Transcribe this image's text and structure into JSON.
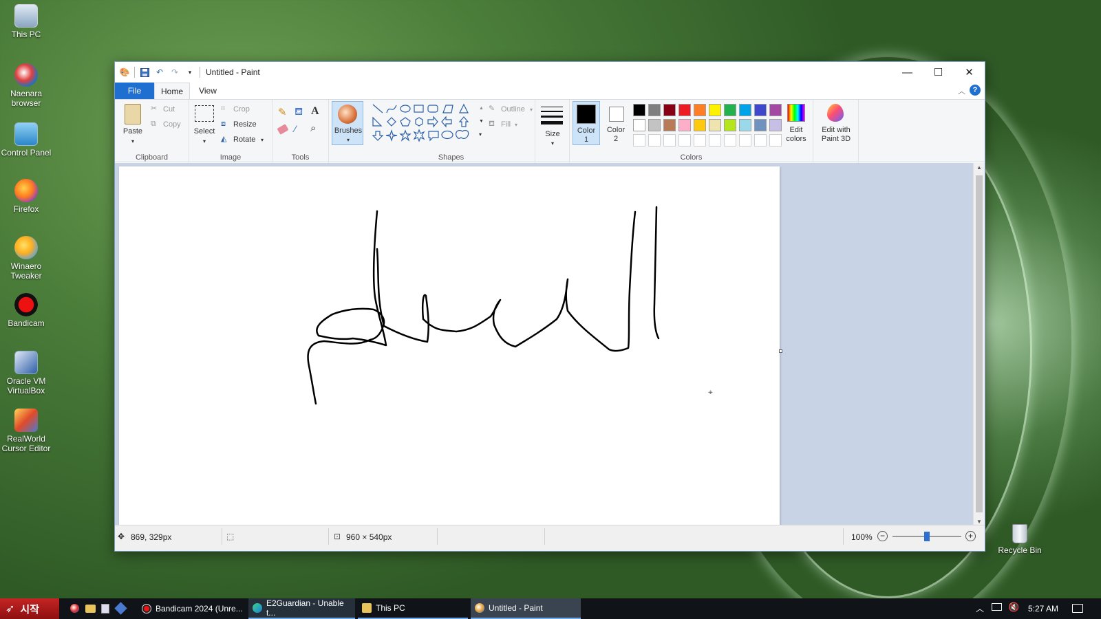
{
  "desktop": {
    "icons": [
      {
        "label": "This PC",
        "icon": "computer-icon"
      },
      {
        "label": "Naenara browser",
        "icon": "globe-browser-icon"
      },
      {
        "label": "Control Panel",
        "icon": "control-panel-icon"
      },
      {
        "label": "Firefox",
        "icon": "firefox-icon"
      },
      {
        "label": "Winaero Tweaker",
        "icon": "tweaker-icon"
      },
      {
        "label": "Bandicam",
        "icon": "record-icon"
      },
      {
        "label": "Oracle VM VirtualBox",
        "icon": "virtualbox-icon"
      },
      {
        "label": "RealWorld Cursor Editor",
        "icon": "cursor-editor-icon"
      },
      {
        "label": "Recycle Bin",
        "icon": "recycle-bin-icon"
      }
    ]
  },
  "window": {
    "title": "Untitled - Paint",
    "tabs": [
      "File",
      "Home",
      "View"
    ],
    "controls": {
      "minimize": "—",
      "maximize": "☐",
      "close": "✕"
    }
  },
  "ribbon": {
    "clipboard": {
      "label": "Clipboard",
      "paste": "Paste",
      "cut": "Cut",
      "copy": "Copy"
    },
    "image": {
      "label": "Image",
      "select": "Select",
      "crop": "Crop",
      "resize": "Resize",
      "rotate": "Rotate"
    },
    "tools": {
      "label": "Tools"
    },
    "brushes": {
      "label": "Brushes"
    },
    "shapes": {
      "label": "Shapes",
      "outline": "Outline",
      "fill": "Fill"
    },
    "size": {
      "label": "Size"
    },
    "colors": {
      "label": "Colors",
      "color1": "Color 1",
      "color2": "Color 2",
      "edit_colors": "Edit colors",
      "color1_value": "#000000",
      "color2_value": "#ffffff",
      "palette_row1": [
        "#000000",
        "#7f7f7f",
        "#880015",
        "#ed1c24",
        "#ff7f27",
        "#fff200",
        "#22b14c",
        "#00a2e8",
        "#3f48cc",
        "#a349a4"
      ],
      "palette_row2": [
        "#ffffff",
        "#c3c3c3",
        "#b97a57",
        "#ffaec9",
        "#ffc90e",
        "#efe4b0",
        "#b5e61d",
        "#99d9ea",
        "#7092be",
        "#c8bfe7"
      ],
      "palette_row3": [
        "#ffffff",
        "#ffffff",
        "#ffffff",
        "#ffffff",
        "#ffffff",
        "#ffffff",
        "#ffffff",
        "#ffffff",
        "#ffffff",
        "#ffffff"
      ]
    },
    "paint3d": {
      "label": "Edit with Paint 3D"
    }
  },
  "statusbar": {
    "cursor_pos": "869, 329px",
    "canvas_size": "960 × 540px",
    "zoom": "100%",
    "zoom_level": 0.5
  },
  "taskbar": {
    "start_label": "시작",
    "items": [
      {
        "label": "Bandicam 2024 (Unre...",
        "icon": "record-icon"
      },
      {
        "label": "E2Guardian - Unable t...",
        "icon": "edge-icon"
      },
      {
        "label": "This PC",
        "icon": "folder-icon"
      },
      {
        "label": "Untitled - Paint",
        "icon": "paint-icon"
      }
    ],
    "clock": "5:27 AM"
  }
}
